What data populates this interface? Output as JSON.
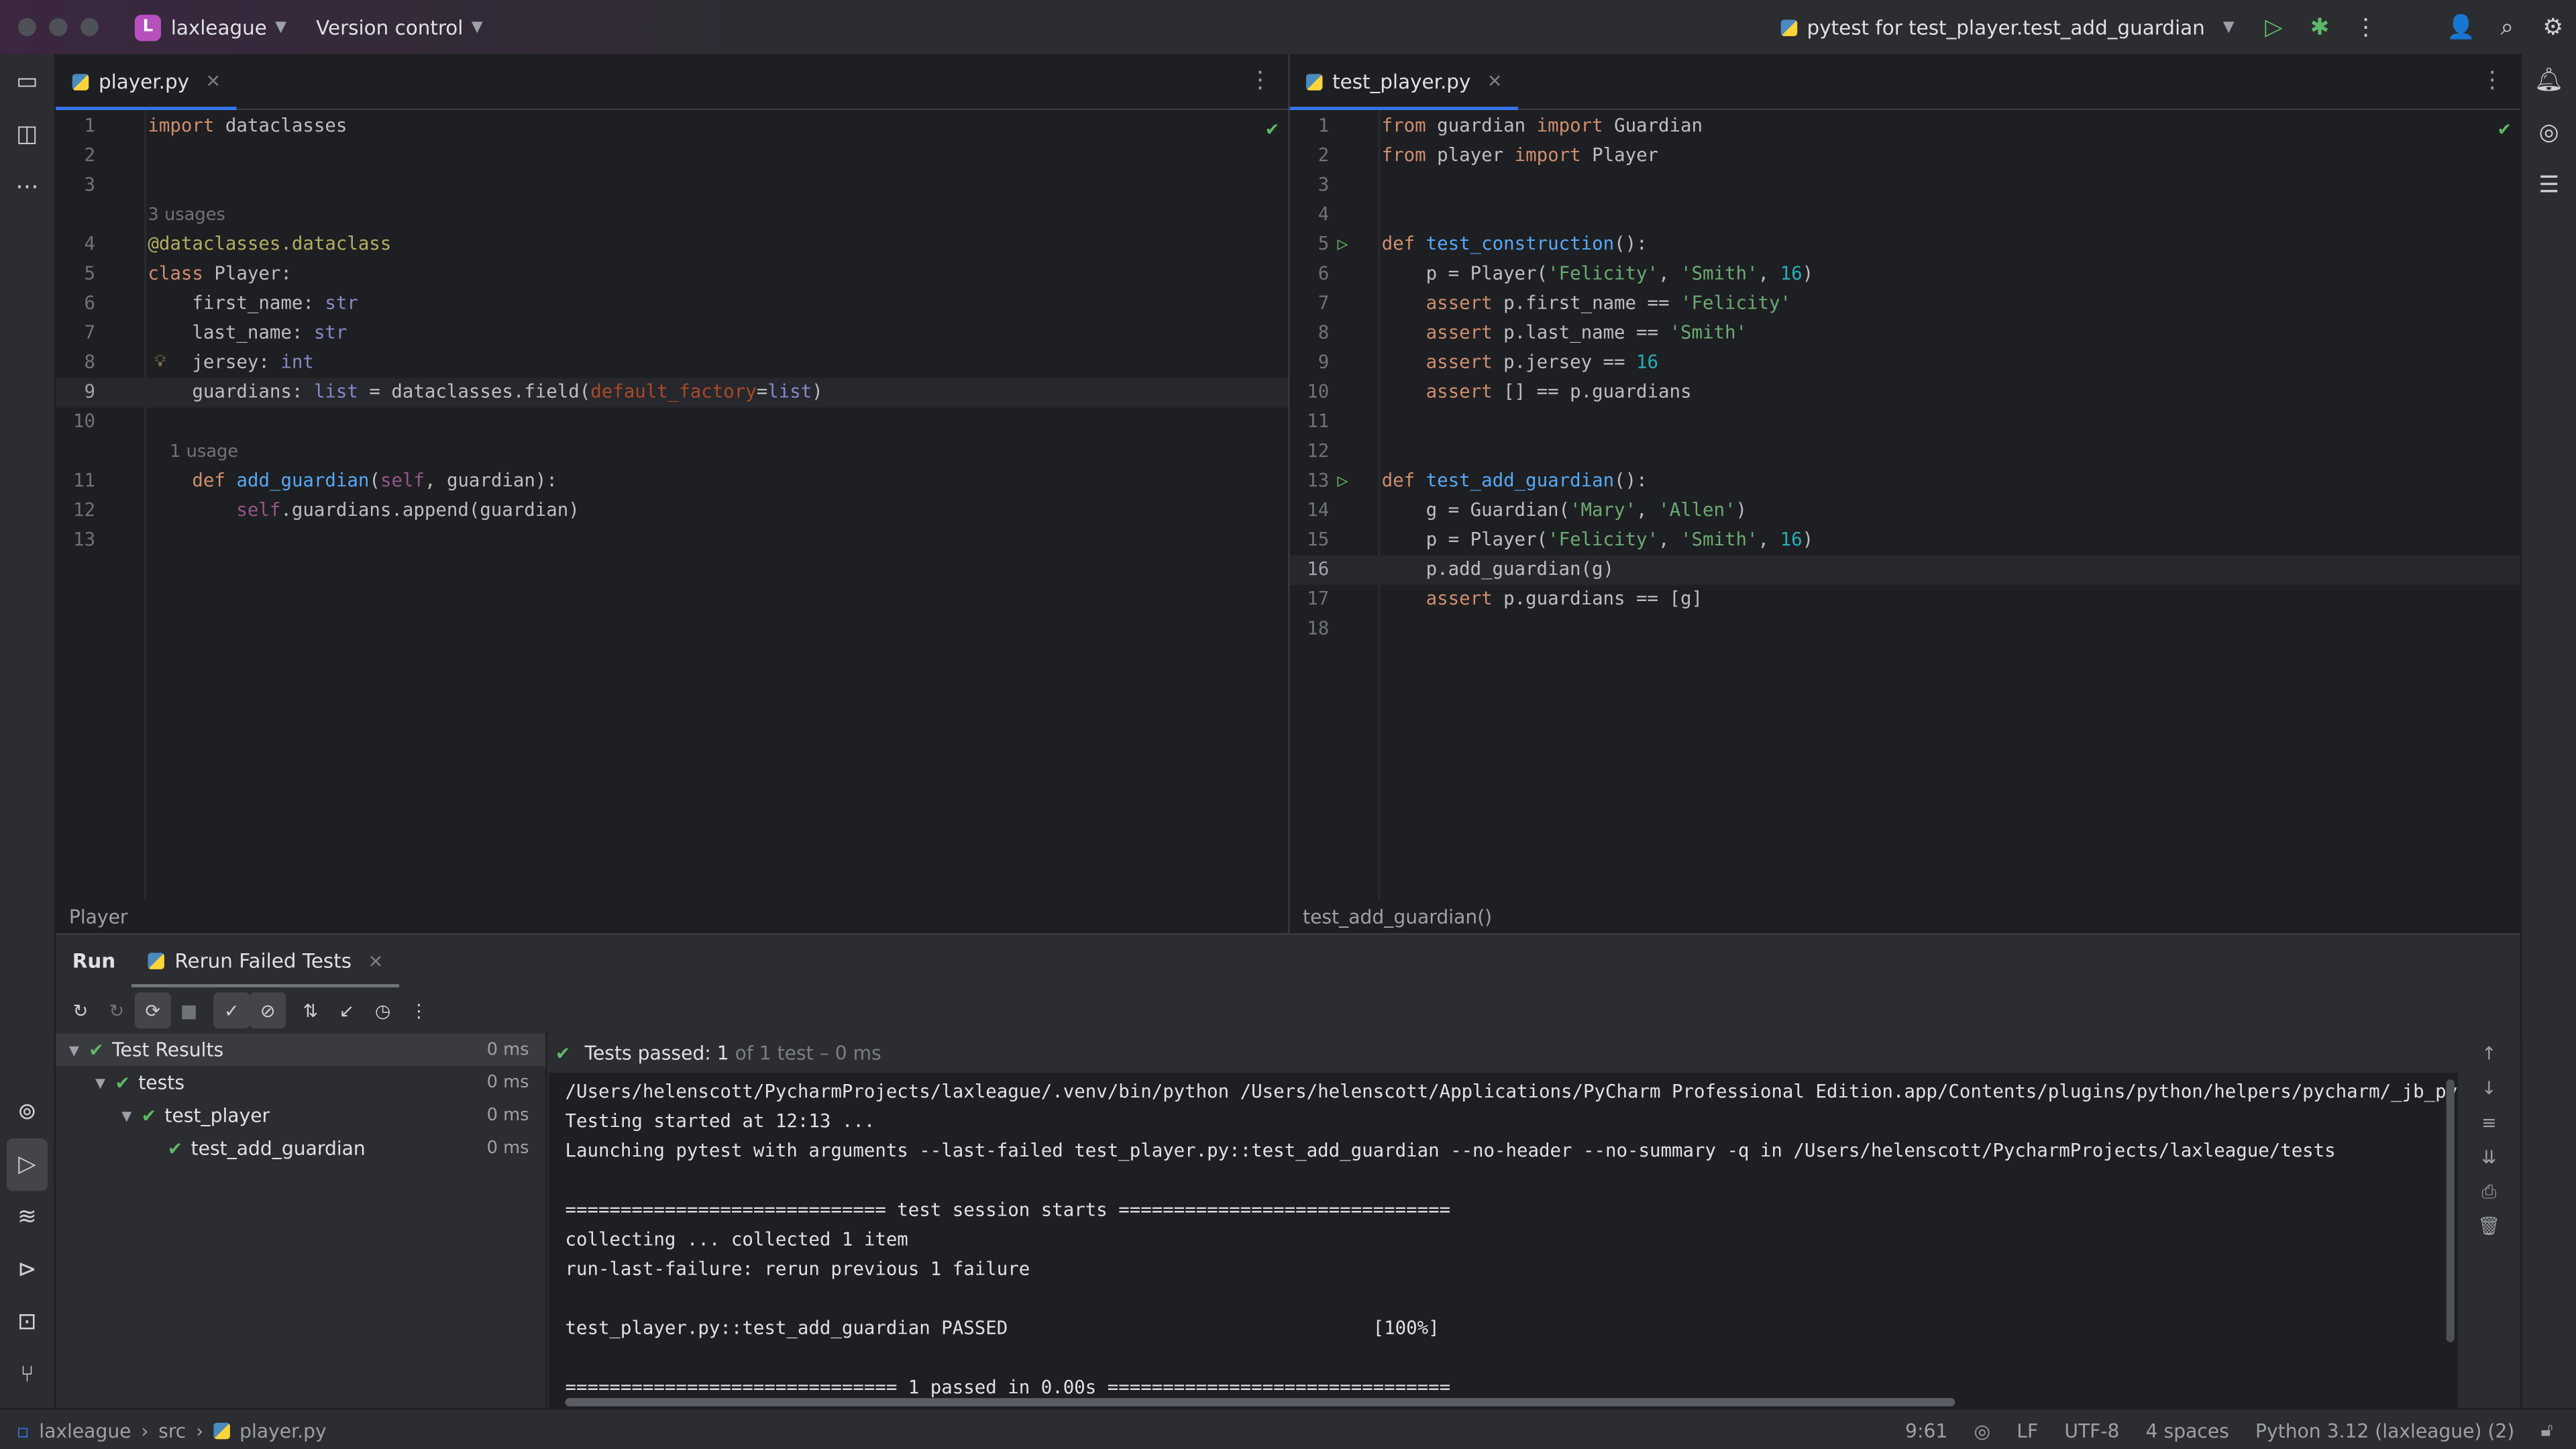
{
  "titlebar": {
    "project_badge": "L",
    "project_name": "laxleague",
    "vcs": "Version control",
    "run_config": "pytest for test_player.test_add_guardian"
  },
  "left_editor": {
    "tab": "player.py",
    "breadcrumb": "Player",
    "lines": [
      {
        "n": "1",
        "html": "<span class='kw'>import</span> dataclasses"
      },
      {
        "n": "2",
        "html": ""
      },
      {
        "n": "3",
        "html": ""
      },
      {
        "n": "",
        "hint": "3 usages"
      },
      {
        "n": "4",
        "html": "<span class='dec'>@dataclasses.dataclass</span>"
      },
      {
        "n": "5",
        "html": "<span class='kw'>class</span> Player:"
      },
      {
        "n": "6",
        "html": "    first_name: <span class='typ'>str</span>"
      },
      {
        "n": "7",
        "html": "    last_name: <span class='typ'>str</span>"
      },
      {
        "n": "8",
        "html": "    jersey: <span class='typ'>int</span>"
      },
      {
        "n": "9",
        "html": "    guardians: <span class='typ'>list</span> = dataclasses.field(<span class='param'>default_factory</span>=<span class='typ'>list</span>)",
        "cur": true
      },
      {
        "n": "10",
        "html": ""
      },
      {
        "n": "",
        "hint": "    1 usage"
      },
      {
        "n": "11",
        "html": "    <span class='kw'>def</span> <span class='fn'>add_guardian</span>(<span class='self'>self</span>, guardian):"
      },
      {
        "n": "12",
        "html": "        <span class='self'>self</span>.guardians.append(guardian)"
      },
      {
        "n": "13",
        "html": ""
      }
    ]
  },
  "right_editor": {
    "tab": "test_player.py",
    "breadcrumb": "test_add_guardian()",
    "lines": [
      {
        "n": "1",
        "html": "<span class='kw'>from</span> guardian <span class='kw'>import</span> Guardian"
      },
      {
        "n": "2",
        "html": "<span class='kw'>from</span> player <span class='kw'>import</span> Player"
      },
      {
        "n": "3",
        "html": ""
      },
      {
        "n": "4",
        "html": ""
      },
      {
        "n": "5",
        "html": "<span class='kw'>def</span> <span class='fn'>test_construction</span>():",
        "run": true
      },
      {
        "n": "6",
        "html": "    p = Player(<span class='str'>'Felicity'</span>, <span class='str'>'Smith'</span>, <span class='num2'>16</span>)"
      },
      {
        "n": "7",
        "html": "    <span class='kw'>assert</span> p.first_name == <span class='str'>'Felicity'</span>"
      },
      {
        "n": "8",
        "html": "    <span class='kw'>assert</span> p.last_name == <span class='str'>'Smith'</span>"
      },
      {
        "n": "9",
        "html": "    <span class='kw'>assert</span> p.jersey == <span class='num2'>16</span>"
      },
      {
        "n": "10",
        "html": "    <span class='kw'>assert</span> [] == p.guardians"
      },
      {
        "n": "11",
        "html": ""
      },
      {
        "n": "12",
        "html": ""
      },
      {
        "n": "13",
        "html": "<span class='kw'>def</span> <span class='fn'>test_add_guardian</span>():",
        "run": true
      },
      {
        "n": "14",
        "html": "    g = Guardian(<span class='str'>'Mary'</span>, <span class='str'>'Allen'</span>)"
      },
      {
        "n": "15",
        "html": "    p = Player(<span class='str'>'Felicity'</span>, <span class='str'>'Smith'</span>, <span class='num2'>16</span>)"
      },
      {
        "n": "16",
        "html": "    p.add_guardian(g)",
        "cur": true
      },
      {
        "n": "17",
        "html": "    <span class='kw'>assert</span> p.guardians == [g]"
      },
      {
        "n": "18",
        "html": ""
      }
    ]
  },
  "run_panel": {
    "tab_run": "Run",
    "tab_rerun": "Rerun Failed Tests",
    "tree": [
      {
        "label": "Test Results",
        "time": "0 ms",
        "indent": 0,
        "arrow": true,
        "sel": true
      },
      {
        "label": "tests",
        "time": "0 ms",
        "indent": 1,
        "arrow": true
      },
      {
        "label": "test_player",
        "time": "0 ms",
        "indent": 2,
        "arrow": true
      },
      {
        "label": "test_add_guardian",
        "time": "0 ms",
        "indent": 3,
        "arrow": false
      }
    ],
    "status_main": "Tests passed: 1",
    "status_dim": " of 1 test – 0 ms",
    "console": [
      "/Users/helenscott/PycharmProjects/laxleague/.venv/bin/python /Users/helenscott/Applications/PyCharm Professional Edition.app/Contents/plugins/python/helpers/pycharm/_jb_pytest_runner.py",
      "Testing started at 12:13 ...",
      "Launching pytest with arguments --last-failed test_player.py::test_add_guardian --no-header --no-summary -q in /Users/helenscott/PycharmProjects/laxleague/tests",
      "",
      "============================= test session starts ==============================",
      "collecting ... collected 1 item",
      "run-last-failure: rerun previous 1 failure",
      "",
      "test_player.py::test_add_guardian PASSED                                 [100%]",
      "",
      "============================== 1 passed in 0.00s ==============================="
    ]
  },
  "statusbar": {
    "crumb1": "laxleague",
    "crumb2": "src",
    "crumb3": "player.py",
    "position": "9:61",
    "line_sep": "LF",
    "encoding": "UTF-8",
    "indent": "4 spaces",
    "interpreter": "Python 3.12 (laxleague) (2)"
  }
}
